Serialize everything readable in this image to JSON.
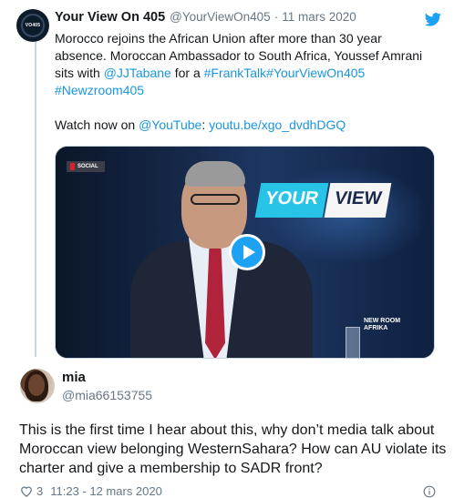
{
  "tweet": {
    "author_name": "Your View On 405",
    "author_handle": "@YourViewOn405",
    "separator": "·",
    "date": "11 mars 2020",
    "avatar_label": "VO405",
    "line1": "Morocco rejoins the African Union after more than 30 year",
    "line2": "absence. Moroccan Ambassador to South Africa, Youssef Amrani",
    "line3_prefix": "sits with ",
    "mention": "@JJTabane",
    "line3_mid": " for a ",
    "hashtag1": "#FrankTalk",
    "hashtag2": "#YourViewOn405",
    "hashtag3": "#Newzroom405",
    "watch_prefix": "Watch now on ",
    "youtube_mention": "@YouTube",
    "watch_link": "youtu.be/xgo_dvdhDGQ",
    "icon": "twitter-bird-icon",
    "accent_color": "#1b95e0"
  },
  "video": {
    "social_tag": "SOCIAL",
    "logo_part1": "YOUR",
    "logo_part2": "VIEW",
    "channel_line1": "NEW ROOM",
    "channel_line2": "AFRIKA",
    "play_icon": "play-icon"
  },
  "reply": {
    "author_name": "mia",
    "author_handle": "@mia66153755",
    "text": "This is the first time I hear about this, why don’t media talk about Moroccan view belonging WesternSahara? How can AU violate its charter and give a membership to SADR front?",
    "likes": "3",
    "timestamp": "11:23 - 12 mars 2020",
    "like_icon": "heart-icon",
    "info_icon": "info-icon"
  }
}
